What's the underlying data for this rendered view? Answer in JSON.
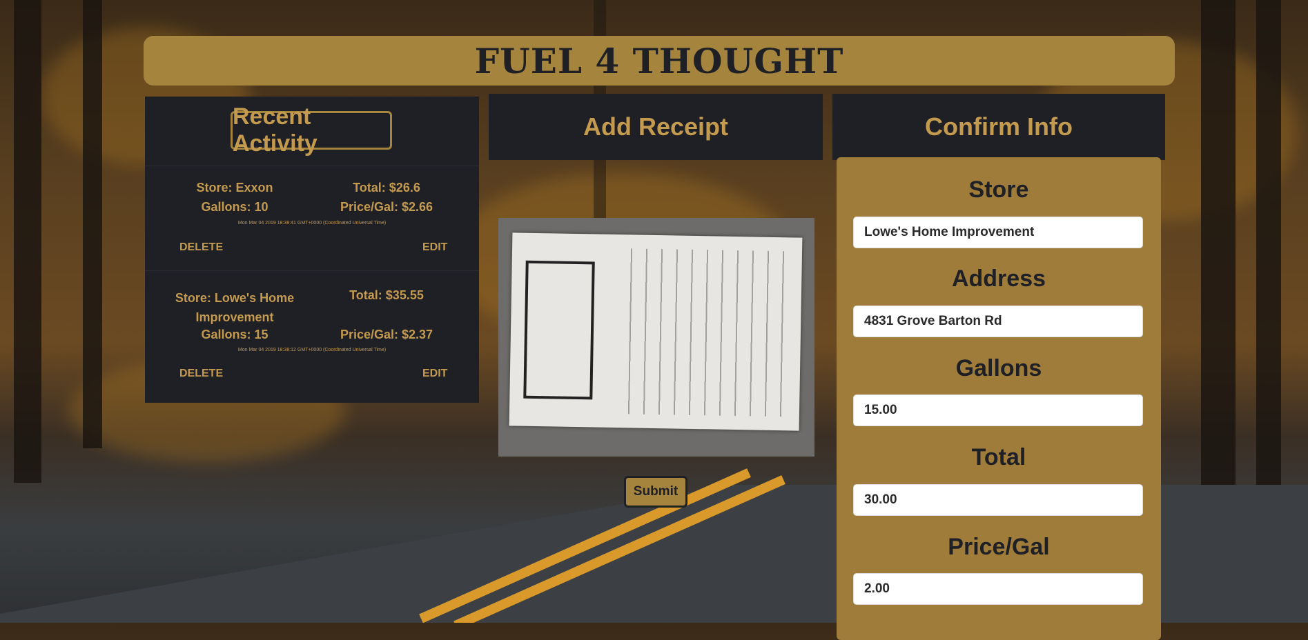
{
  "header": {
    "title": "FUEL 4 THOUGHT"
  },
  "recent": {
    "title": "Recent Activity",
    "entries": [
      {
        "store": "Store: Exxon",
        "total": "Total: $26.6",
        "gallons": "Gallons: 10",
        "price": "Price/Gal: $2.66",
        "timestamp": "Mon Mar 04 2019 18:38:41 GMT+0000 (Coordinated Universal Time)",
        "delete": "DELETE",
        "edit": "EDIT"
      },
      {
        "store": "Store: Lowe's Home Improvement",
        "total": "Total: $35.55",
        "gallons": "Gallons: 15",
        "price": "Price/Gal: $2.37",
        "timestamp": "Mon Mar 04 2019 18:38:12 GMT+0000 (Coordinated Universal Time)",
        "delete": "DELETE",
        "edit": "EDIT"
      }
    ]
  },
  "add": {
    "title": "Add Receipt",
    "submit": "Submit"
  },
  "confirm": {
    "title": "Confirm Info",
    "fields": [
      {
        "label": "Store",
        "value": "Lowe's Home Improvement"
      },
      {
        "label": "Address",
        "value": "4831 Grove Barton Rd"
      },
      {
        "label": "Gallons",
        "value": "15.00"
      },
      {
        "label": "Total",
        "value": "30.00"
      },
      {
        "label": "Price/Gal",
        "value": "2.00"
      }
    ]
  },
  "colors": {
    "accent": "#a5843d",
    "panel": "#1f2026",
    "text_gold": "#c49a4e"
  }
}
